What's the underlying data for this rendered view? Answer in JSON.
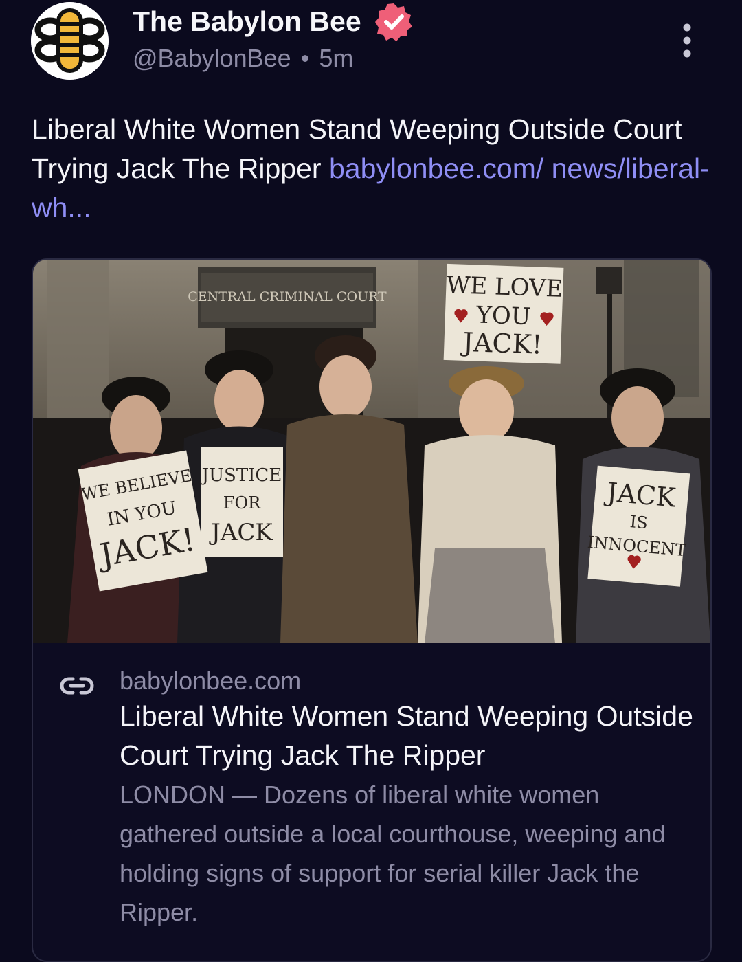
{
  "author": {
    "name": "The Babylon Bee",
    "handle": "@BabylonBee",
    "separator": "•",
    "time": "5m"
  },
  "post": {
    "text": "Liberal White Women Stand Weeping Outside Court Trying Jack The Ripper",
    "link_text": "babylonbee.com/ news/liberal-wh..."
  },
  "image": {
    "court_sign": "CENTRAL CRIMINAL COURT",
    "sign1": [
      "WE LOVE",
      "YOU",
      "JACK!"
    ],
    "sign2": [
      "WE BELIEVE",
      "IN YOU",
      "JACK!"
    ],
    "sign3": [
      "JUSTICE",
      "FOR",
      "JACK"
    ],
    "sign4": [
      "JACK",
      "IS",
      "INNOCENT"
    ]
  },
  "card": {
    "domain": "babylonbee.com",
    "title": "Liberal White Women Stand Weeping Outside Court Trying Jack The Ripper",
    "description": "LONDON — Dozens of liberal white women gathered outside a local courthouse, weeping and holding signs of support for serial killer Jack the Ripper."
  },
  "colors": {
    "background": "#0b0a1e",
    "link": "#8f8ef5",
    "verified": "#ef5f78",
    "muted": "#8e8ca6",
    "logo_yellow": "#f2b83a"
  },
  "icons": [
    "babylon-bee-logo-icon",
    "verified-badge-icon",
    "more-options-icon",
    "link-icon"
  ]
}
